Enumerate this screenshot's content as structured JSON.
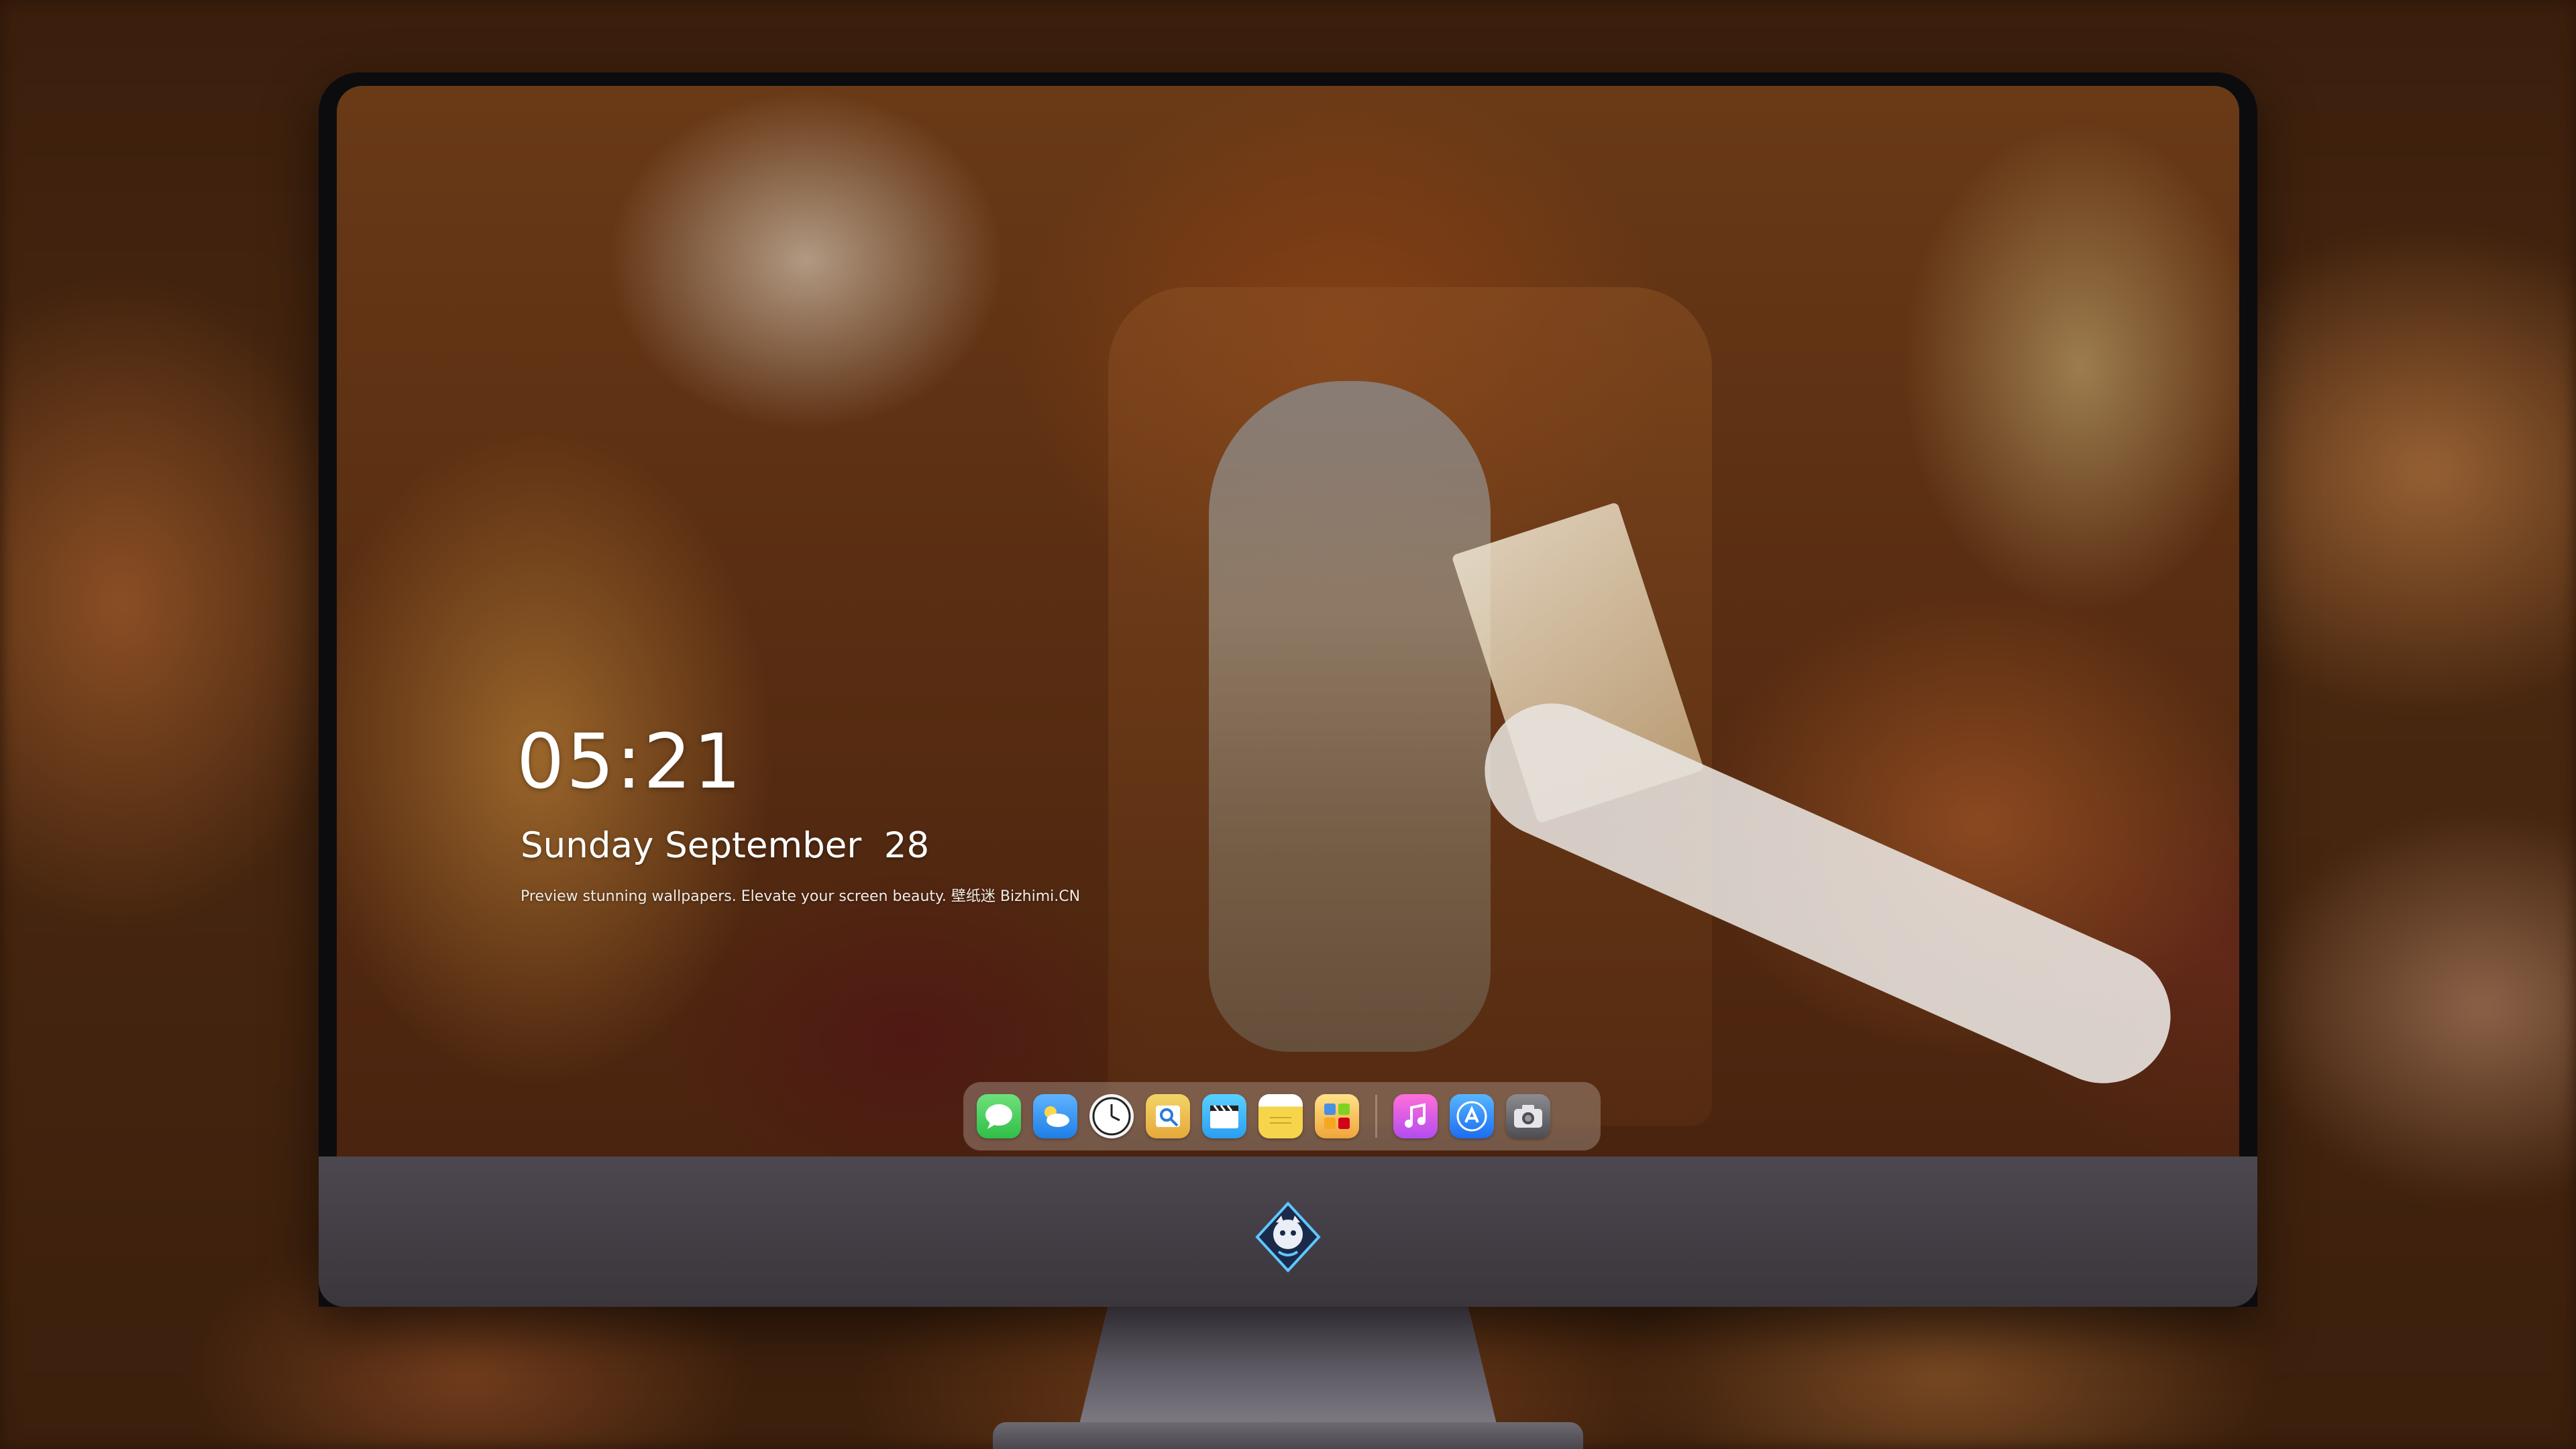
{
  "lockscreen": {
    "time": "05:21",
    "date": "Sunday September  28",
    "tagline": "Preview stunning wallpapers. Elevate your screen beauty. 壁纸迷 Bizhimi.CN"
  },
  "dock": {
    "apps": [
      {
        "name": "messages-icon",
        "color": "#34C759"
      },
      {
        "name": "weather-icon",
        "color": "#2F8BFF"
      },
      {
        "name": "clock-icon",
        "color": "#F4F4F4"
      },
      {
        "name": "preview-icon",
        "color": "#E6A93A"
      },
      {
        "name": "clips-icon",
        "color": "#2B9EF0"
      },
      {
        "name": "notes-icon",
        "color": "#F7D54A"
      },
      {
        "name": "dashboard-icon",
        "color": "#F0A53A"
      },
      {
        "name": "music-icon",
        "color": "#D34CF0"
      },
      {
        "name": "app-store-icon",
        "color": "#1B6DF2"
      },
      {
        "name": "camera-icon",
        "color": "#6A6A70"
      }
    ]
  },
  "monitor": {
    "logo": "mascot-logo-icon",
    "bezel_color": "#0C0C0E",
    "chin_color": "#45404A"
  }
}
